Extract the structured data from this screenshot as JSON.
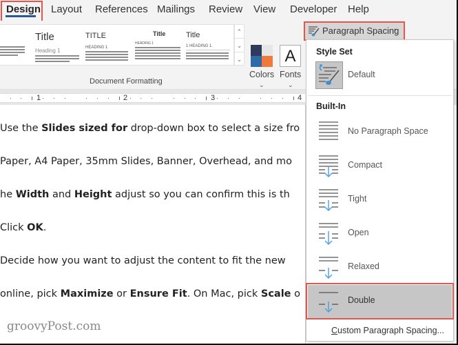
{
  "ribbon_tabs": [
    {
      "label": "Design",
      "active": true
    },
    {
      "label": "Layout",
      "active": false
    },
    {
      "label": "References",
      "active": false
    },
    {
      "label": "Mailings",
      "active": false
    },
    {
      "label": "Review",
      "active": false
    },
    {
      "label": "View",
      "active": false
    },
    {
      "label": "Developer",
      "active": false
    },
    {
      "label": "Help",
      "active": false
    }
  ],
  "style_gallery": {
    "thumbnails": [
      {
        "title": "",
        "heading": ""
      },
      {
        "title": "Title",
        "heading": "Heading 1"
      },
      {
        "title": "TITLE",
        "heading": "HEADING 1"
      },
      {
        "title": "Title",
        "heading": "HEADING 1"
      },
      {
        "title": "Title",
        "heading": "1   HEADING 1"
      }
    ],
    "group_label": "Document Formatting"
  },
  "ribbon_buttons": {
    "colors": "Colors",
    "fonts": "Fonts",
    "fonts_glyph": "A",
    "paragraph_spacing": "Paragraph Spacing"
  },
  "brand_colors": {
    "accent_blue": "#2b5797",
    "highlight_red": "#e8534a",
    "color_swatches": [
      "#2d3a5c",
      "#e6e6e6",
      "#2e6aa8",
      "#ef7a3c"
    ],
    "arrow_blue": "#4a9fe0"
  },
  "ruler": {
    "numbers": [
      "1",
      "2",
      "3",
      "4"
    ]
  },
  "document": {
    "paragraphs": [
      [
        {
          "t": "Use the ",
          "b": false
        },
        {
          "t": "Slides sized for",
          "b": true
        },
        {
          "t": " drop-down box to select a size fro",
          "b": false
        }
      ],
      [
        {
          "t": "Paper, A4 Paper, 35mm Slides, Banner, Overhead, and mo",
          "b": false
        }
      ],
      [
        {
          "t": "he ",
          "b": false
        },
        {
          "t": "Width",
          "b": true
        },
        {
          "t": " and ",
          "b": false
        },
        {
          "t": "Height",
          "b": true
        },
        {
          "t": " adjust so you can confirm this is th",
          "b": false
        }
      ],
      [
        {
          "t": "Click ",
          "b": false
        },
        {
          "t": "OK",
          "b": true
        },
        {
          "t": ".",
          "b": false
        }
      ],
      [
        {
          "t": "Decide how you want to adjust the content to fit the new",
          "b": false
        }
      ],
      [
        {
          "t": "online, pick ",
          "b": false
        },
        {
          "t": "Maximize",
          "b": true
        },
        {
          "t": " or ",
          "b": false
        },
        {
          "t": "Ensure Fit",
          "b": true
        },
        {
          "t": ". On Mac, pick ",
          "b": false
        },
        {
          "t": "Scale",
          "b": true
        },
        {
          "t": " o",
          "b": false
        }
      ]
    ],
    "watermark": "groovyPost.com"
  },
  "dropdown": {
    "style_set_header": "Style Set",
    "default_label": "Default",
    "builtin_header": "Built-In",
    "items": [
      {
        "label": "No Paragraph Space",
        "icon": "no-paragraph-space-icon",
        "selected": false
      },
      {
        "label": "Compact",
        "icon": "compact-spacing-icon",
        "selected": false
      },
      {
        "label": "Tight",
        "icon": "tight-spacing-icon",
        "selected": false
      },
      {
        "label": "Open",
        "icon": "open-spacing-icon",
        "selected": false
      },
      {
        "label": "Relaxed",
        "icon": "relaxed-spacing-icon",
        "selected": false
      },
      {
        "label": "Double",
        "icon": "double-spacing-icon",
        "selected": true
      }
    ],
    "custom_first_letter": "C",
    "custom_rest": "ustom Paragraph Spacing..."
  }
}
